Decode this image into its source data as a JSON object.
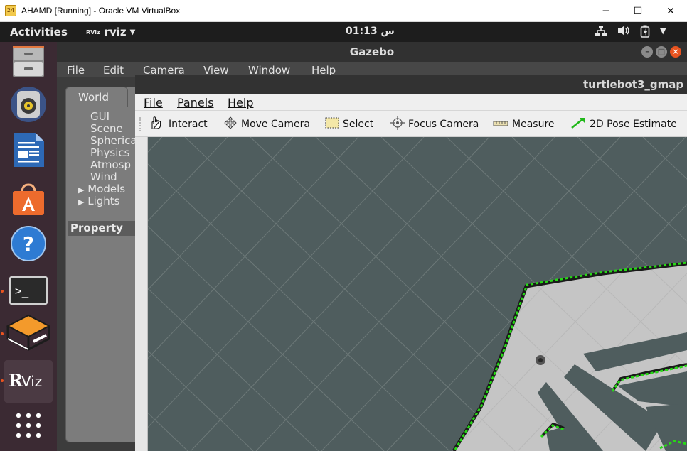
{
  "host_window": {
    "title": "AHAMD [Running] - Oracle VM VirtualBox",
    "app_icon_text": "24",
    "minimize": "─",
    "maximize": "☐",
    "close": "✕"
  },
  "ubuntu_topbar": {
    "activities": "Activities",
    "app_mini_label": "RViz",
    "app_name": "rviz",
    "clock": "01:13 س",
    "indicators": [
      "network-icon",
      "volume-icon",
      "battery-icon",
      "chevron-down-icon"
    ]
  },
  "dock": {
    "items": [
      {
        "name": "files",
        "icon": "file-cabinet-icon"
      },
      {
        "name": "rhythmbox",
        "icon": "speaker-icon"
      },
      {
        "name": "writer",
        "icon": "document-icon"
      },
      {
        "name": "software",
        "icon": "shopping-bag-icon"
      },
      {
        "name": "help",
        "icon": "help-icon",
        "glyph": "?"
      },
      {
        "name": "terminal",
        "icon": "terminal-icon",
        "glyph": ">_"
      },
      {
        "name": "gazebo",
        "icon": "gazebo-icon"
      },
      {
        "name": "rviz",
        "icon": "rviz-icon",
        "glyph": "RViz"
      },
      {
        "name": "show-apps",
        "icon": "grid-icon"
      }
    ]
  },
  "gazebo": {
    "title": "Gazebo",
    "window_buttons": [
      "–",
      "□",
      "×"
    ],
    "menu": [
      "File",
      "Edit",
      "Camera",
      "View",
      "Window",
      "Help"
    ],
    "world_tab": "World",
    "tree": [
      "GUI",
      "Scene",
      "Spherica",
      "Physics",
      "Atmosp",
      "Wind",
      "Models",
      "Lights"
    ],
    "property": "Property"
  },
  "rviz": {
    "title": "turtlebot3_gmap",
    "menu": [
      "File",
      "Panels",
      "Help"
    ],
    "toolbar": [
      {
        "label": "Interact",
        "icon": "hand-pointer-icon"
      },
      {
        "label": "Move Camera",
        "icon": "move-camera-icon"
      },
      {
        "label": "Select",
        "icon": "select-box-icon"
      },
      {
        "label": "Focus Camera",
        "icon": "focus-target-icon"
      },
      {
        "label": "Measure",
        "icon": "ruler-icon"
      },
      {
        "label": "2D Pose Estimate",
        "icon": "green-arrow-icon"
      }
    ]
  },
  "colors": {
    "viewport_bg": "#4f5d5e",
    "map_free": "#c5c5c5",
    "map_wall": "#1a1a1a",
    "laser_scan": "#27d816",
    "ubuntu_orange": "#e95420"
  }
}
